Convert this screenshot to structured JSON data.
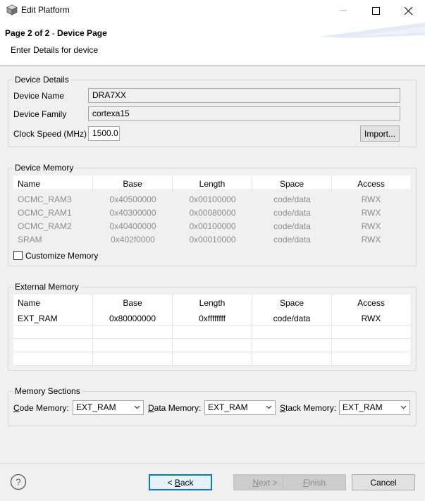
{
  "window": {
    "title": "Edit Platform",
    "icon": "platform-cube-icon"
  },
  "header": {
    "title_bold": "Page 2 of 2",
    "title_sep": " - ",
    "title_rest": "Device Page",
    "subtitle": "Enter Details for device"
  },
  "device_details": {
    "group_label": "Device Details",
    "name_label": "Device Name",
    "name_value": "DRA7XX",
    "family_label": "Device Family",
    "family_value": "cortexa15",
    "clock_label": "Clock Speed (MHz)",
    "clock_value": "1500.0",
    "import_button": "Import..."
  },
  "device_memory": {
    "group_label": "Device Memory",
    "columns": [
      "Name",
      "Base",
      "Length",
      "Space",
      "Access"
    ],
    "rows": [
      [
        "OCMC_RAM3",
        "0x40500000",
        "0x00100000",
        "code/data",
        "RWX"
      ],
      [
        "OCMC_RAM1",
        "0x40300000",
        "0x00080000",
        "code/data",
        "RWX"
      ],
      [
        "OCMC_RAM2",
        "0x40400000",
        "0x00100000",
        "code/data",
        "RWX"
      ],
      [
        "SRAM",
        "0x402f0000",
        "0x00010000",
        "code/data",
        "RWX"
      ]
    ],
    "customize_label": "Customize Memory",
    "customize_checked": false
  },
  "external_memory": {
    "group_label": "External Memory",
    "columns": [
      "Name",
      "Base",
      "Length",
      "Space",
      "Access"
    ],
    "rows": [
      [
        "EXT_RAM",
        "0x80000000",
        "0xffffffff",
        "code/data",
        "RWX"
      ]
    ]
  },
  "memory_sections": {
    "group_label": "Memory Sections",
    "code_label_u": "C",
    "code_label_rest": "ode Memory:",
    "code_value": "EXT_RAM",
    "data_label_u": "D",
    "data_label_rest": "ata Memory:",
    "data_value": "EXT_RAM",
    "stack_label_u": "S",
    "stack_label_rest": "tack Memory:",
    "stack_value": "EXT_RAM"
  },
  "footer": {
    "back_prefix": "< ",
    "back_u": "B",
    "back_rest": "ack",
    "next_u": "N",
    "next_rest": "ext >",
    "finish_u": "F",
    "finish_rest": "inish",
    "cancel": "Cancel"
  }
}
